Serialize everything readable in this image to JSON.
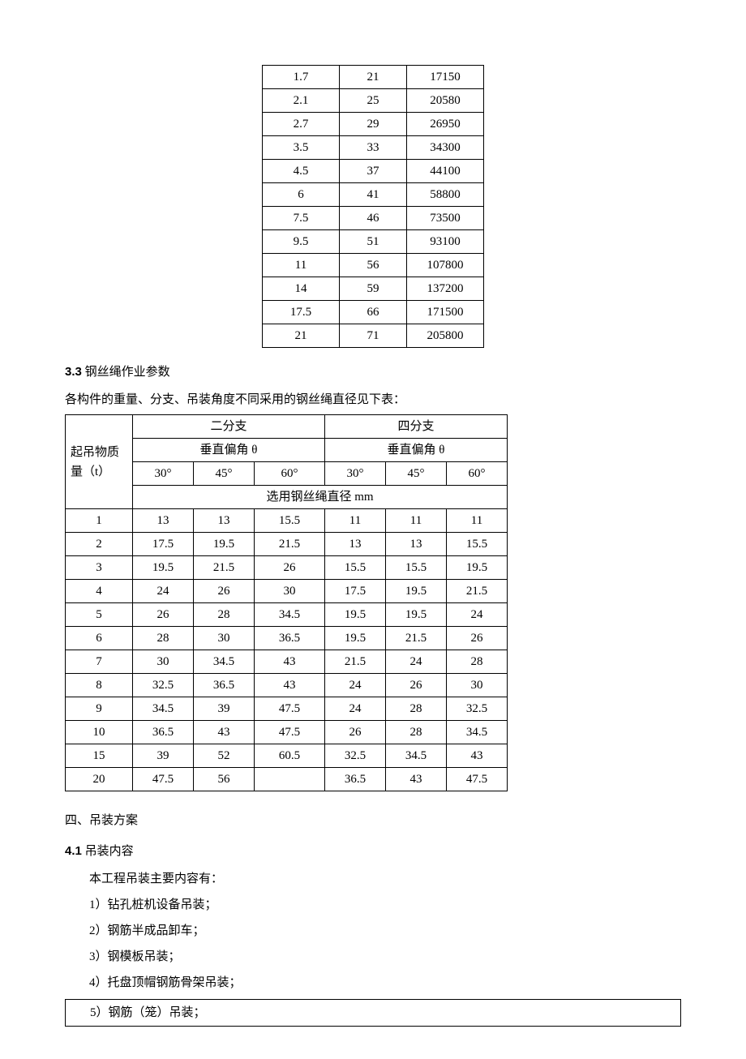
{
  "table1": {
    "rows": [
      [
        "1.7",
        "21",
        "17150"
      ],
      [
        "2.1",
        "25",
        "20580"
      ],
      [
        "2.7",
        "29",
        "26950"
      ],
      [
        "3.5",
        "33",
        "34300"
      ],
      [
        "4.5",
        "37",
        "44100"
      ],
      [
        "6",
        "41",
        "58800"
      ],
      [
        "7.5",
        "46",
        "73500"
      ],
      [
        "9.5",
        "51",
        "93100"
      ],
      [
        "11",
        "56",
        "107800"
      ],
      [
        "14",
        "59",
        "137200"
      ],
      [
        "17.5",
        "66",
        "171500"
      ],
      [
        "21",
        "71",
        "205800"
      ]
    ]
  },
  "sec33": {
    "num": "3.3",
    "title": " 钢丝绳作业参数",
    "intro": "各构件的重量、分支、吊装角度不同采用的钢丝绳直径见下表：",
    "header": {
      "rowhead": "起吊物质量（t）",
      "two": "二分支",
      "four": "四分支",
      "angle": "垂直偏角 θ",
      "a30": "30°",
      "a45": "45°",
      "a60": "60°",
      "diam": "选用钢丝绳直径 mm"
    },
    "rows": [
      [
        "1",
        "13",
        "13",
        "15.5",
        "11",
        "11",
        "11"
      ],
      [
        "2",
        "17.5",
        "19.5",
        "21.5",
        "13",
        "13",
        "15.5"
      ],
      [
        "3",
        "19.5",
        "21.5",
        "26",
        "15.5",
        "15.5",
        "19.5"
      ],
      [
        "4",
        "24",
        "26",
        "30",
        "17.5",
        "19.5",
        "21.5"
      ],
      [
        "5",
        "26",
        "28",
        "34.5",
        "19.5",
        "19.5",
        "24"
      ],
      [
        "6",
        "28",
        "30",
        "36.5",
        "19.5",
        "21.5",
        "26"
      ],
      [
        "7",
        "30",
        "34.5",
        "43",
        "21.5",
        "24",
        "28"
      ],
      [
        "8",
        "32.5",
        "36.5",
        "43",
        "24",
        "26",
        "30"
      ],
      [
        "9",
        "34.5",
        "39",
        "47.5",
        "24",
        "28",
        "32.5"
      ],
      [
        "10",
        "36.5",
        "43",
        "47.5",
        "26",
        "28",
        "34.5"
      ],
      [
        "15",
        "39",
        "52",
        "60.5",
        "32.5",
        "34.5",
        "43"
      ],
      [
        "20",
        "47.5",
        "56",
        "",
        "36.5",
        "43",
        "47.5"
      ]
    ]
  },
  "sec4": {
    "title": "四、吊装方案",
    "sec41_num": "4.1",
    "sec41_title": " 吊装内容",
    "intro": "本工程吊装主要内容有：",
    "items": [
      "1）钻孔桩机设备吊装；",
      "2）钢筋半成品卸车；",
      "3）钢模板吊装；",
      "4）托盘顶帽钢筋骨架吊装；",
      "5）钢筋（笼）吊装；"
    ]
  }
}
